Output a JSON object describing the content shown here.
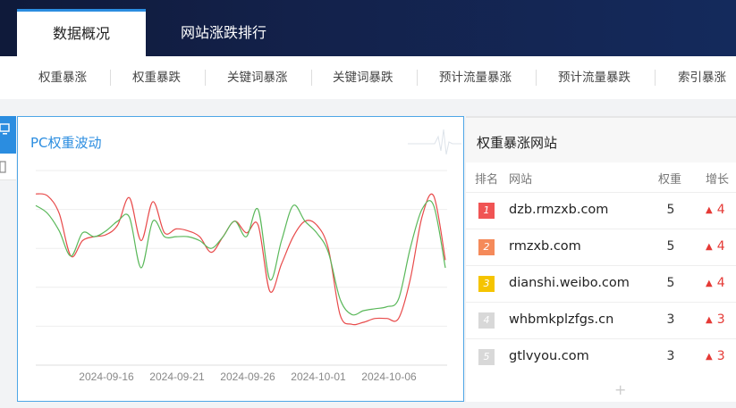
{
  "header": {
    "tabs": [
      {
        "label": "数据概况",
        "active": true
      },
      {
        "label": "网站涨跌排行",
        "active": false
      }
    ]
  },
  "subnav": {
    "items": [
      "权重暴涨",
      "权重暴跌",
      "关键词暴涨",
      "关键词暴跌",
      "预计流量暴涨",
      "预计流量暴跌",
      "索引暴涨"
    ]
  },
  "chart_panel": {
    "title": "PC权重波动"
  },
  "chart_data": {
    "type": "line",
    "x_ticks": [
      "2024-09-16",
      "2024-09-21",
      "2024-09-26",
      "2024-10-01",
      "2024-10-06"
    ],
    "grid": true,
    "series": [
      {
        "color": "#e84a4a",
        "values": [
          4.4,
          4.35,
          3.9,
          2.8,
          3.2,
          3.3,
          3.35,
          3.6,
          4.3,
          3.2,
          4.2,
          3.4,
          3.5,
          3.45,
          3.3,
          2.9,
          3.3,
          3.7,
          3.4,
          3.6,
          1.9,
          2.6,
          3.3,
          3.7,
          3.6,
          3.0,
          1.3,
          1.05,
          1.1,
          1.2,
          1.2,
          1.2,
          2.2,
          3.8,
          4.35,
          2.7
        ]
      },
      {
        "color": "#5ab85a",
        "values": [
          4.1,
          3.9,
          3.45,
          2.8,
          3.4,
          3.3,
          3.45,
          3.7,
          3.8,
          2.5,
          3.7,
          3.3,
          3.3,
          3.3,
          3.2,
          3.0,
          3.3,
          3.7,
          3.3,
          4.0,
          2.2,
          3.2,
          4.1,
          3.7,
          3.4,
          2.9,
          1.7,
          1.3,
          1.4,
          1.45,
          1.5,
          1.7,
          3.0,
          4.0,
          4.1,
          2.5
        ]
      }
    ]
  },
  "ranking": {
    "title": "权重暴涨网站",
    "columns": {
      "rank": "排名",
      "site": "网站",
      "weight": "权重",
      "growth": "增长"
    },
    "rows": [
      {
        "rank": "1",
        "site": "dzb.rmzxb.com",
        "weight": "5",
        "growth": "4",
        "badge_color": "#f05454"
      },
      {
        "rank": "2",
        "site": "rmzxb.com",
        "weight": "5",
        "growth": "4",
        "badge_color": "#f58a5a"
      },
      {
        "rank": "3",
        "site": "dianshi.weibo.com",
        "weight": "5",
        "growth": "4",
        "badge_color": "#f5c400"
      },
      {
        "rank": "4",
        "site": "whbmkplzfgs.cn",
        "weight": "3",
        "growth": "3",
        "badge_color": "#d8d8d8"
      },
      {
        "rank": "5",
        "site": "gtlvyou.com",
        "weight": "3",
        "growth": "3",
        "badge_color": "#d8d8d8"
      }
    ]
  }
}
